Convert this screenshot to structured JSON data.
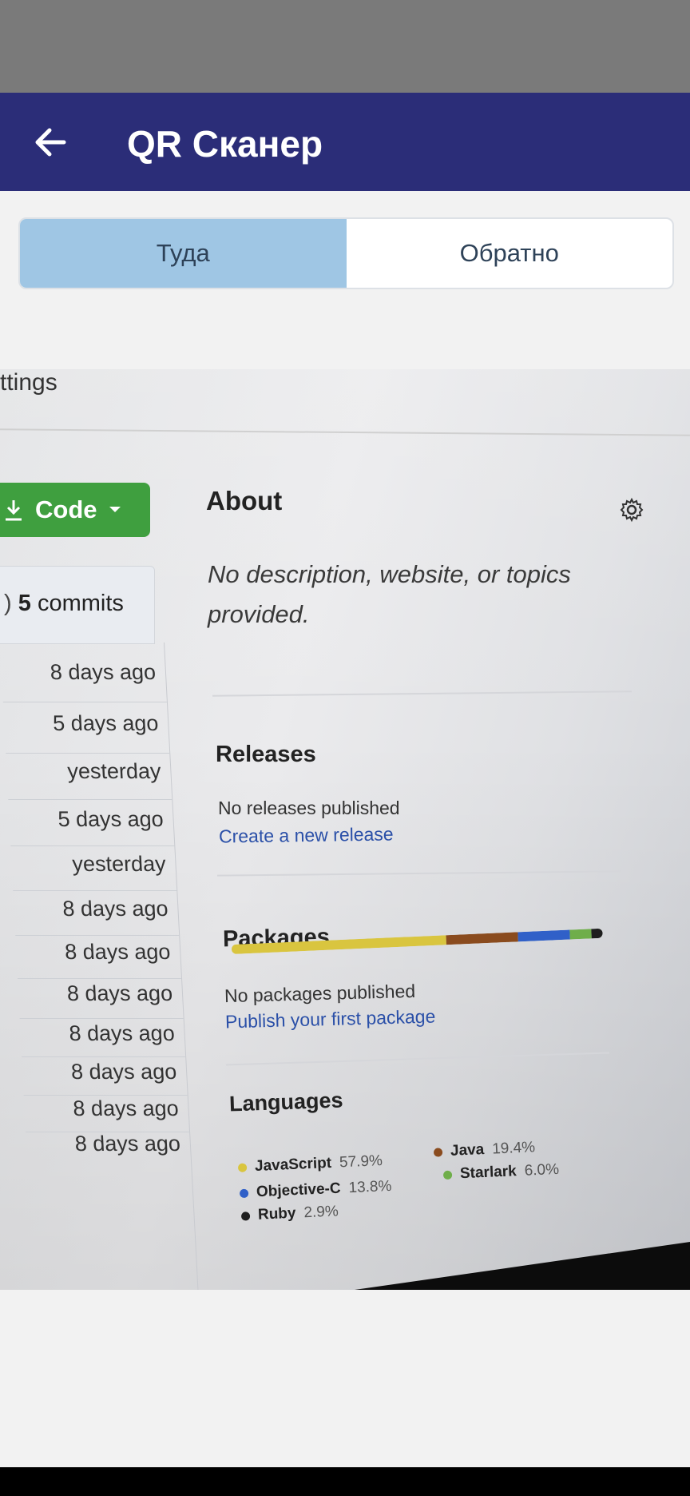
{
  "app": {
    "title": "QR Сканер"
  },
  "tabs": [
    {
      "label": "Туда",
      "active": true
    },
    {
      "label": "Обратно",
      "active": false
    }
  ],
  "photo": {
    "settings_fragment": "ttings",
    "code_button_label": "Code",
    "commits_count": "5",
    "commits_label": "commits",
    "commit_times": [
      "8 days ago",
      "5 days ago",
      "yesterday",
      "5 days ago",
      "yesterday",
      "8 days ago",
      "8 days ago",
      "8 days ago",
      "8 days ago",
      "8 days ago",
      "8 days ago",
      "8 days ago"
    ],
    "about": {
      "heading": "About",
      "description": "No description, website, or topics provided."
    },
    "releases": {
      "heading": "Releases",
      "status": "No releases published",
      "link": "Create a new release"
    },
    "packages": {
      "heading": "Packages",
      "status": "No packages published",
      "link": "Publish your first package"
    },
    "languages": {
      "heading": "Languages",
      "items": [
        {
          "name": "JavaScript",
          "percent": "57.9%",
          "value": 57.9,
          "color": "#d9c53f"
        },
        {
          "name": "Java",
          "percent": "19.4%",
          "value": 19.4,
          "color": "#8a4b1e"
        },
        {
          "name": "Objective-C",
          "percent": "13.8%",
          "value": 13.8,
          "color": "#3060c8"
        },
        {
          "name": "Starlark",
          "percent": "6.0%",
          "value": 6.0,
          "color": "#6fae4a"
        },
        {
          "name": "Ruby",
          "percent": "2.9%",
          "value": 2.9,
          "color": "#1e1e1e"
        }
      ]
    }
  },
  "colors": {
    "appbar": "#2b2d78",
    "tab_active": "#9fc6e4",
    "code_button": "#3f9f3f"
  }
}
